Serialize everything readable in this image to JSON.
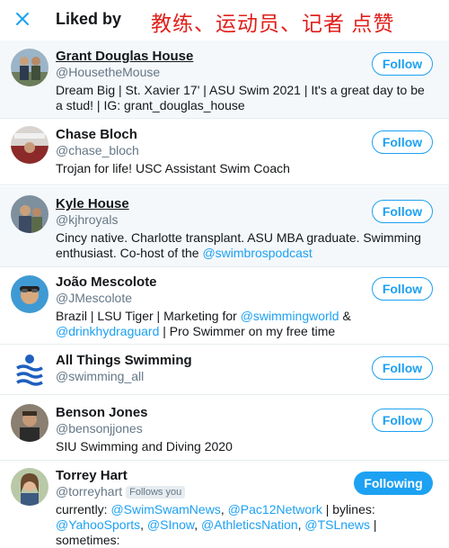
{
  "header": {
    "title": "Liked by",
    "overlay_caption": "教练、运动员、记者 点赞"
  },
  "users": [
    {
      "name": "Grant Douglas House",
      "handle": "@HousetheMouse",
      "bio": "Dream Big | St. Xavier 17' | ASU Swim 2021 | It's a great day to be a stud! | IG: grant_douglas_house",
      "button": "Follow"
    },
    {
      "name": "Chase Bloch",
      "handle": "@chase_bloch",
      "bio": "Trojan for life! USC Assistant Swim Coach",
      "button": "Follow"
    },
    {
      "name": "Kyle House",
      "handle": "@kjhroyals",
      "bio_a": "Cincy native. Charlotte transplant. ASU MBA graduate. Swimming enthusiast. Co-host of the ",
      "bio_link": "@swimbrospodcast",
      "button": "Follow"
    },
    {
      "name": "João Mescolote",
      "handle": "@JMescolote",
      "bio_a": "Brazil | LSU Tiger | Marketing for ",
      "bio_link1": "@swimmingworld",
      "bio_b": " & ",
      "bio_link2": "@drinkhydraguard",
      "bio_c": " | Pro Swimmer on my free time",
      "button": "Follow"
    },
    {
      "name": "All Things Swimming",
      "handle": "@swimming_all",
      "button": "Follow"
    },
    {
      "name": "Benson Jones",
      "handle": "@bensonjjones",
      "bio": "SIU Swimming and Diving 2020",
      "button": "Follow"
    },
    {
      "name": "Torrey Hart",
      "handle": "@torreyhart",
      "follows_you": "Follows you",
      "bio_a": "currently: ",
      "link1": "@SwimSwamNews",
      "sep1": ", ",
      "link2": "@Pac12Network",
      "bio_b": " | bylines: ",
      "link3": "@YahooSports",
      "sep2": ", ",
      "link4": "@SInow",
      "sep3": ", ",
      "link5": "@AthleticsNation",
      "sep4": ", ",
      "link6": "@TSLnews",
      "bio_c": " | sometimes:",
      "button": "Following"
    }
  ],
  "colors": {
    "accent": "#1da1f2",
    "overlay_text": "#e0201c",
    "shaded_row": "#f5f8fa"
  }
}
